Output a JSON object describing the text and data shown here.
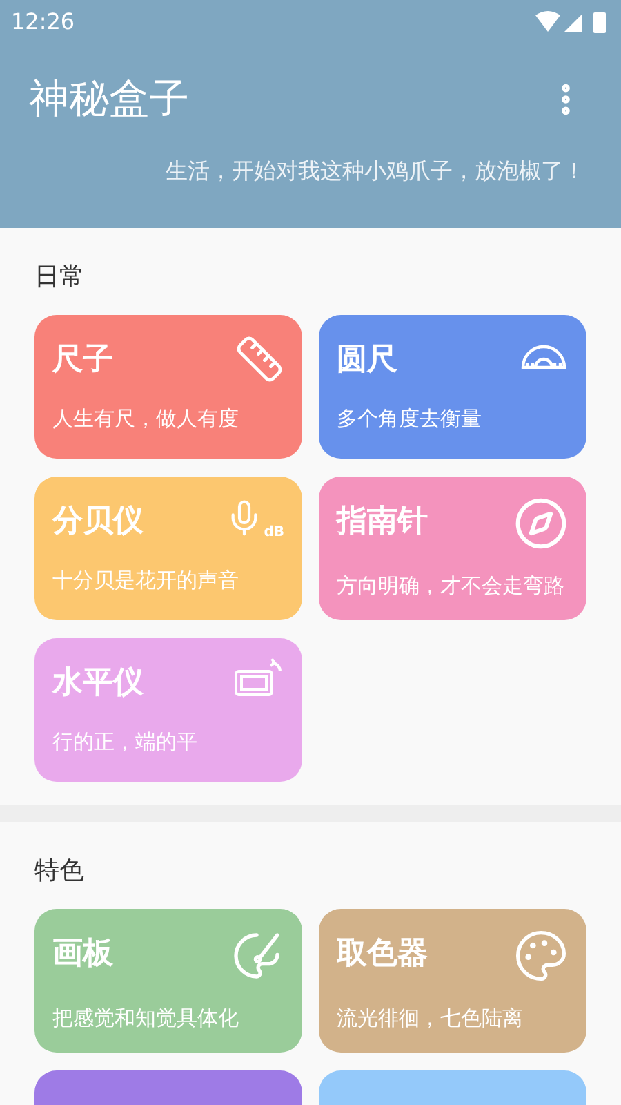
{
  "status_bar": {
    "time": "12:26"
  },
  "app_bar": {
    "title": "神秘盒子",
    "subtitle": "生活，开始对我这种小鸡爪子，放泡椒了！"
  },
  "sections": [
    {
      "title": "日常",
      "cards": [
        {
          "title": "尺子",
          "subtitle": "人生有尺，做人有度",
          "color": "#f88179",
          "kind": "ruler"
        },
        {
          "title": "圆尺",
          "subtitle": "多个角度去衡量",
          "color": "#6791ec",
          "kind": "protractor"
        },
        {
          "title": "分贝仪",
          "subtitle": "十分贝是花开的声音",
          "color": "#fcc76f",
          "kind": "decibel",
          "icon_text": "dB"
        },
        {
          "title": "指南针",
          "subtitle": "方向明确，才不会走弯路",
          "color": "#f493bd",
          "kind": "compass"
        },
        {
          "title": "水平仪",
          "subtitle": "行的正，端的平",
          "color": "#e9a9ec",
          "kind": "level"
        }
      ]
    },
    {
      "title": "特色",
      "cards": [
        {
          "title": "画板",
          "subtitle": "把感觉和知觉具体化",
          "color": "#9acc9a",
          "kind": "brush"
        },
        {
          "title": "取色器",
          "subtitle": "流光徘徊，七色陆离",
          "color": "#d2b28a",
          "kind": "palette"
        },
        {
          "color": "#9e7be6"
        },
        {
          "color": "#94c9fa"
        }
      ]
    }
  ]
}
